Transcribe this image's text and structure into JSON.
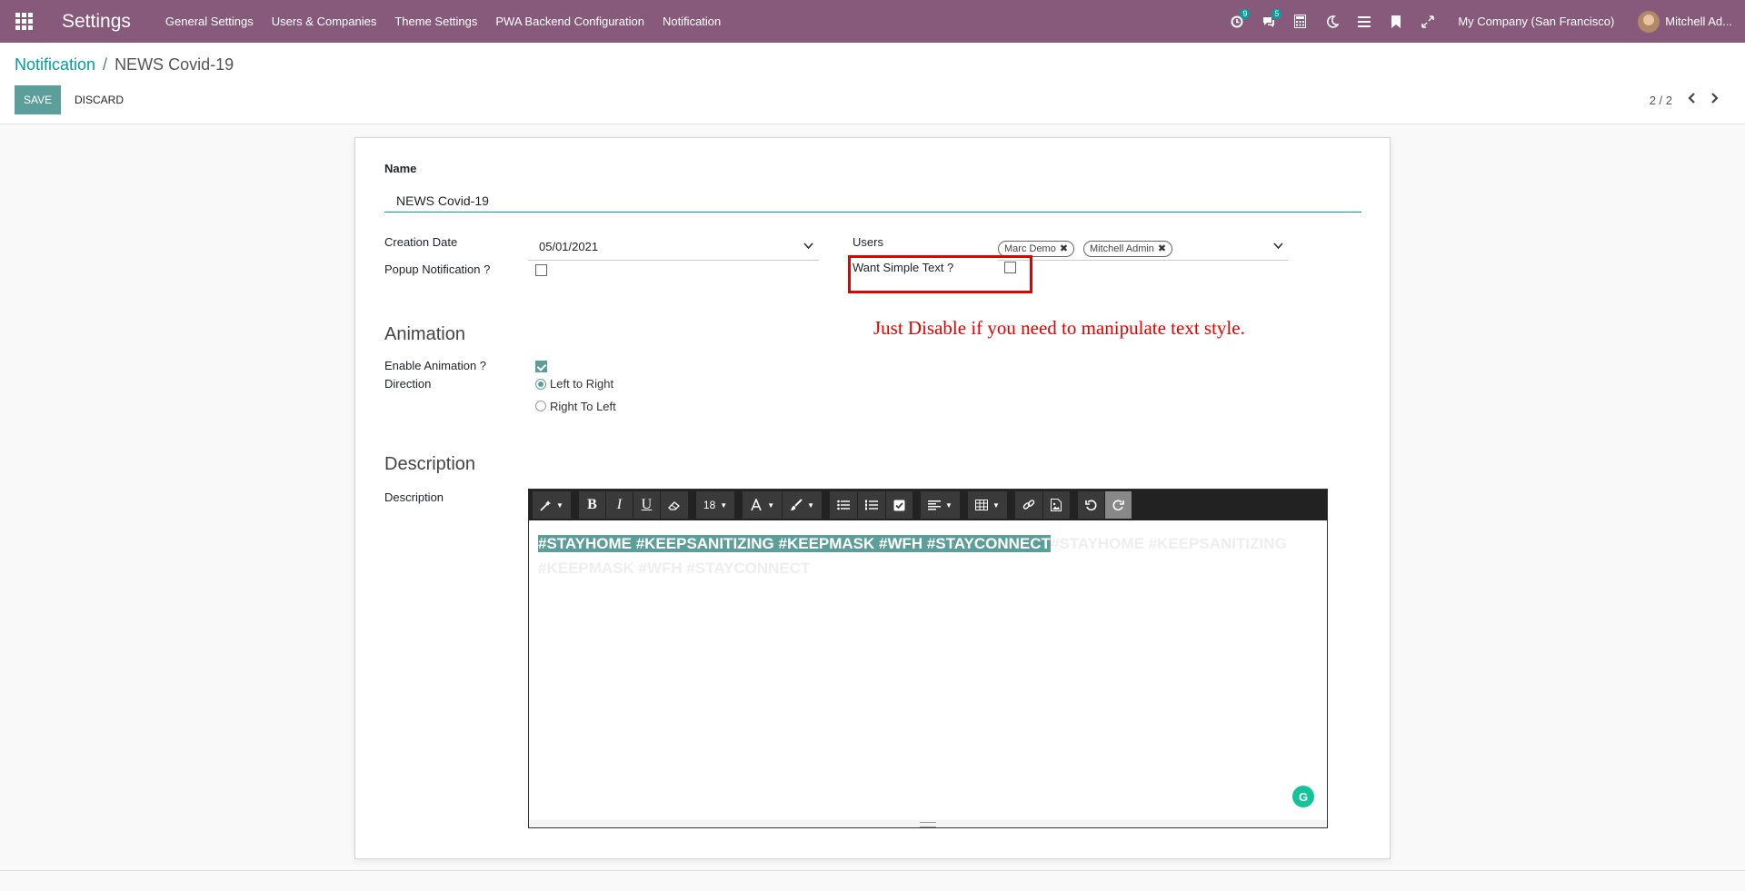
{
  "navbar": {
    "brand": "Settings",
    "menu": [
      "General Settings",
      "Users & Companies",
      "Theme Settings",
      "PWA Backend Configuration",
      "Notification"
    ],
    "activity_badge": "9",
    "messages_badge": "5",
    "company": "My Company (San Francisco)",
    "user": "Mitchell Ad..."
  },
  "breadcrumb": {
    "parent": "Notification",
    "separator": "/",
    "current": "NEWS Covid-19"
  },
  "buttons": {
    "save": "Save",
    "discard": "Discard"
  },
  "pager": {
    "value": "2 / 2"
  },
  "form": {
    "name_label": "Name",
    "name_value": "NEWS Covid-19",
    "creation_date_label": "Creation Date",
    "creation_date_value": "05/01/2021",
    "popup_label": "Popup Notification ?",
    "popup_checked": false,
    "users_label": "Users",
    "users": [
      "Marc Demo",
      "Mitchell Admin"
    ],
    "simple_text_label": "Want Simple Text ?",
    "simple_text_checked": false,
    "annotation": "Just Disable  if you need to manipulate text style.",
    "animation_title": "Animation",
    "enable_animation_label": "Enable Animation ?",
    "enable_animation_checked": true,
    "direction_label": "Direction",
    "direction_options": [
      "Left to Right",
      "Right To Left"
    ],
    "direction_selected": "Left to Right",
    "description_title": "Description",
    "description_label": "Description",
    "font_size": "18",
    "description_text": "#STAYHOME  #KEEPSANITIZING  #KEEPMASK  #WFH  #STAYCONNECT",
    "description_ghost_line1": "#STAYHOME  #KEEPSANITIZING",
    "description_ghost_line2": "#KEEPMASK  #WFH  #STAYCONNECT"
  },
  "colors": {
    "navbar": "#875a7b",
    "accent": "#00a09d",
    "button": "#5c9e9a",
    "annotation": "#e30000"
  }
}
